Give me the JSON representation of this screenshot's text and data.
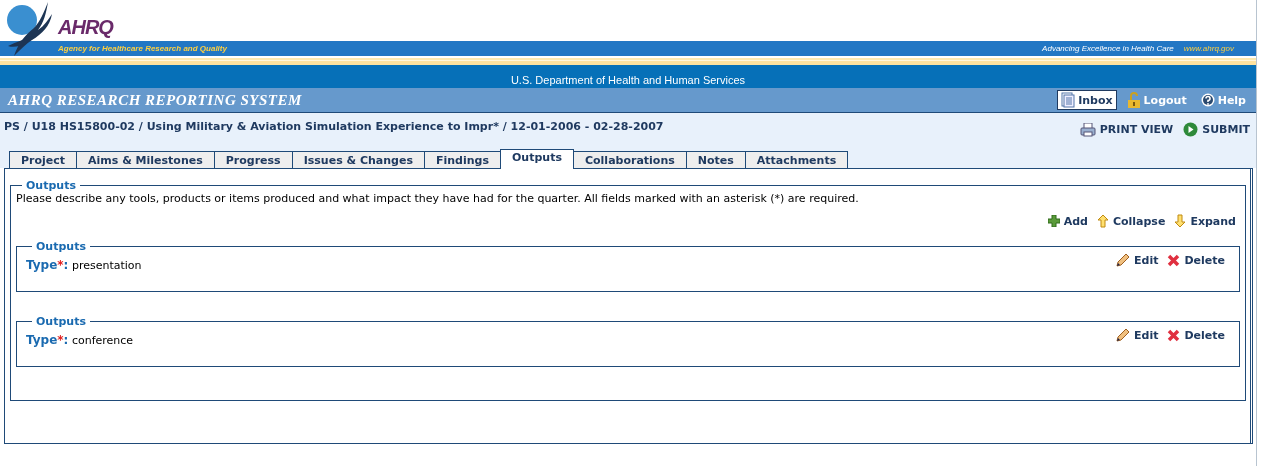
{
  "header": {
    "logo_text": "AHRQ",
    "agency": "Agency for Healthcare Research and Quality",
    "tagline": "Advancing Excellence in Health Care",
    "url": "www.ahrq.gov",
    "department": "U.S. Department of Health and Human Services"
  },
  "app_title": "AHRQ RESEARCH REPORTING SYSTEM",
  "nav_links": [
    {
      "kind": "inbox",
      "label": "Inbox",
      "selected": true
    },
    {
      "kind": "logout",
      "label": "Logout",
      "selected": false
    },
    {
      "kind": "help",
      "label": "Help",
      "selected": false
    }
  ],
  "breadcrumb": "PS / U18 HS15800-02 / Using Military & Aviation Simulation Experience to Impr* / 12-01-2006 - 02-28-2007",
  "page_actions": [
    {
      "kind": "print",
      "label": "PRINT VIEW"
    },
    {
      "kind": "submit",
      "label": "SUBMIT"
    }
  ],
  "tabs": [
    {
      "label": "Project",
      "selected": false
    },
    {
      "label": "Aims & Milestones",
      "selected": false
    },
    {
      "label": "Progress",
      "selected": false
    },
    {
      "label": "Issues & Changes",
      "selected": false
    },
    {
      "label": "Findings",
      "selected": false
    },
    {
      "label": "Outputs",
      "selected": true
    },
    {
      "label": "Collaborations",
      "selected": false
    },
    {
      "label": "Notes",
      "selected": false
    },
    {
      "label": "Attachments",
      "selected": false
    }
  ],
  "section": {
    "legend": "Outputs",
    "description": "Please describe any tools, products or items produced and what impact they have had for the quarter. All fields marked with an asterisk (*) are required.",
    "tools": [
      {
        "kind": "add",
        "label": "Add"
      },
      {
        "kind": "collapse",
        "label": "Collapse"
      },
      {
        "kind": "expand",
        "label": "Expand"
      }
    ],
    "items": [
      {
        "legend": "Outputs",
        "label": "Type",
        "required_mark": "*",
        "separator": ":",
        "value": "presentation",
        "actions": [
          {
            "kind": "edit",
            "label": "Edit"
          },
          {
            "kind": "delete",
            "label": "Delete"
          }
        ]
      },
      {
        "legend": "Outputs",
        "label": "Type",
        "required_mark": "*",
        "separator": ":",
        "value": "conference",
        "actions": [
          {
            "kind": "edit",
            "label": "Edit"
          },
          {
            "kind": "delete",
            "label": "Delete"
          }
        ]
      }
    ]
  }
}
